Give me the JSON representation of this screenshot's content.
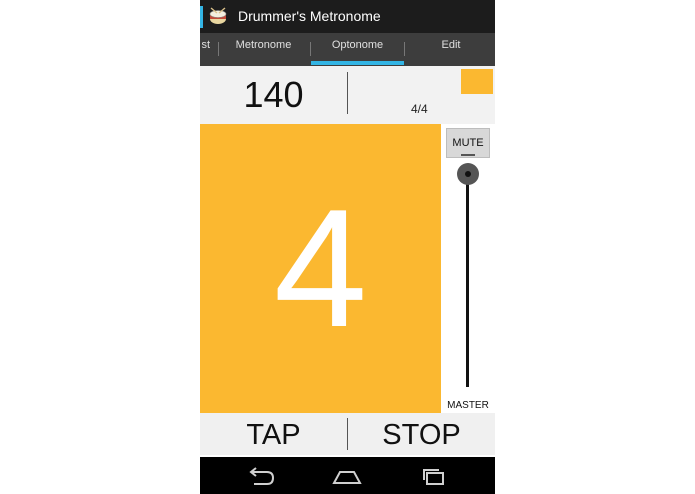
{
  "app": {
    "title": "Drummer's Metronome"
  },
  "tabs": [
    {
      "label": "st"
    },
    {
      "label": "Metronome"
    },
    {
      "label": "Optonome",
      "selected": true
    },
    {
      "label": "Edit"
    }
  ],
  "header": {
    "bpm": "140",
    "time_signature": "4/4"
  },
  "beat": {
    "current": "4"
  },
  "controls": {
    "mute_label": "MUTE",
    "master_label": "MASTER",
    "master_level": 1.0
  },
  "buttons": {
    "tap": "TAP",
    "stop": "STOP"
  },
  "icons": {
    "app": "drum-icon",
    "back": "back-icon",
    "home": "home-icon",
    "recents": "recents-icon"
  },
  "colors": {
    "accent": "#33b5e5",
    "beat": "#fbb830",
    "action_bar": "#1c1c1c",
    "tab_bar": "#3d3d3d"
  }
}
